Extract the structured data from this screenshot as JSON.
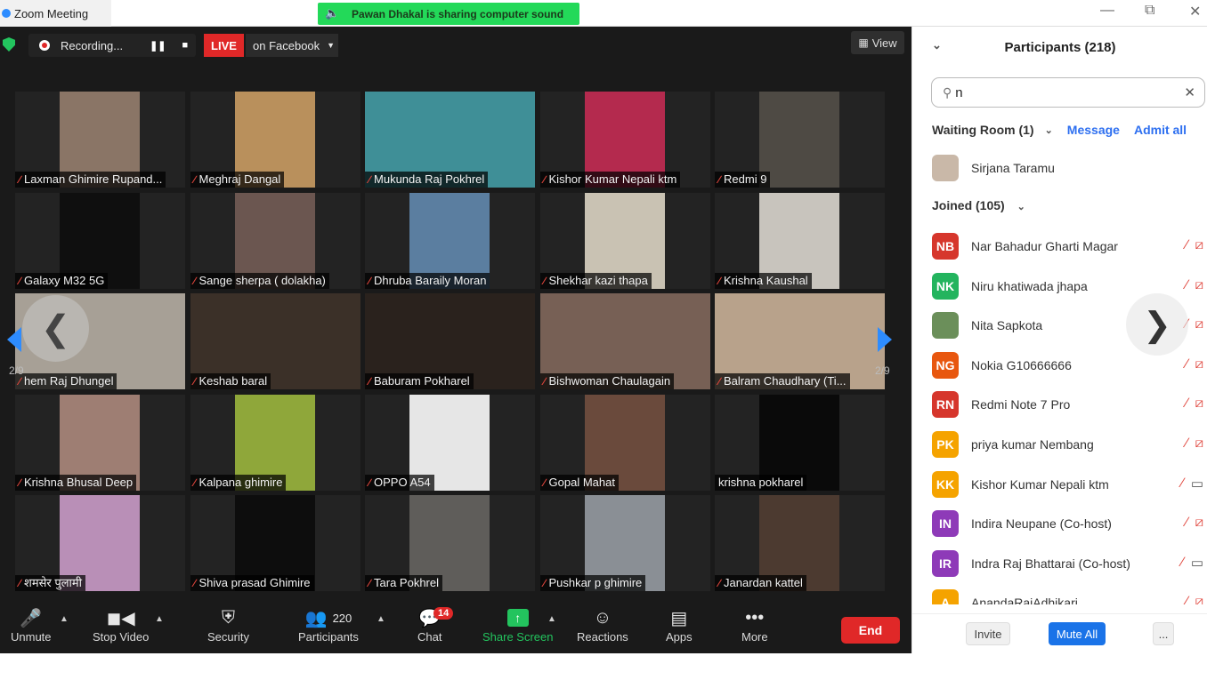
{
  "window": {
    "title": "Zoom Meeting",
    "share_banner": "Pawan Dhakal is sharing computer sound"
  },
  "topbar": {
    "recording_label": "Recording...",
    "live_label": "LIVE",
    "live_target": "on Facebook",
    "view_label": "View"
  },
  "grid": {
    "page_indicator": "2/9",
    "tiles": [
      {
        "name": "Laxman Ghimire Rupand...",
        "bg": "#8a7566"
      },
      {
        "name": "Meghraj Dangal",
        "bg": "#b9905c"
      },
      {
        "name": "Mukunda Raj  Pokhrel",
        "bg": "#3f8f97"
      },
      {
        "name": "Kishor Kumar Nepali ktm",
        "bg": "#b42a4e"
      },
      {
        "name": "Redmi 9",
        "bg": "#4e4a44"
      },
      {
        "name": "Galaxy M32 5G",
        "bg": "#0f0f0f"
      },
      {
        "name": "Sange sherpa ( dolakha)",
        "bg": "#6b5650"
      },
      {
        "name": "Dhruba Baraily Moran",
        "bg": "#5b7ea0"
      },
      {
        "name": "Shekhar kazi thapa",
        "bg": "#c9c2b3"
      },
      {
        "name": "Krishna Kaushal",
        "bg": "#c8c4bd"
      },
      {
        "name": "hem Raj Dhungel",
        "bg": "#a7a096"
      },
      {
        "name": "Keshab baral",
        "bg": "#3b3028"
      },
      {
        "name": "Baburam Pokharel",
        "bg": "#2a221d"
      },
      {
        "name": "Bishwoman Chaulagain",
        "bg": "#776055"
      },
      {
        "name": "Balram Chaudhary (Ti...",
        "bg": "#b8a28b"
      },
      {
        "name": "Krishna Bhusal Deep",
        "bg": "#9e7e73"
      },
      {
        "name": "Kalpana ghimire",
        "bg": "#8fa73a"
      },
      {
        "name": "OPPO A54",
        "bg": "#e6e6e6"
      },
      {
        "name": "Gopal Mahat",
        "bg": "#6a4a3c"
      },
      {
        "name": "krishna pokharel",
        "bg": "#0a0a0a",
        "unmuted": true
      },
      {
        "name": "शमसेर पुलामी",
        "bg": "#b98fb7"
      },
      {
        "name": "Shiva prasad Ghimire",
        "bg": "#0d0d0d"
      },
      {
        "name": "Tara Pokhrel",
        "bg": "#5f5d5a"
      },
      {
        "name": "Pushkar p ghimire",
        "bg": "#8a8f95"
      },
      {
        "name": "Janardan kattel",
        "bg": "#4c3a30"
      }
    ]
  },
  "toolbar": {
    "unmute": "Unmute",
    "stop_video": "Stop Video",
    "security": "Security",
    "participants": "Participants",
    "participants_count": "220",
    "chat": "Chat",
    "chat_badge": "14",
    "share_screen": "Share Screen",
    "reactions": "Reactions",
    "apps": "Apps",
    "more": "More",
    "end": "End"
  },
  "panel": {
    "title": "Participants (218)",
    "search_value": "n",
    "waiting_room_label": "Waiting Room (1)",
    "message_label": "Message",
    "admit_all_label": "Admit all",
    "waiting": [
      {
        "name": "Sirjana Taramu"
      }
    ],
    "joined_label": "Joined (105)",
    "participants": [
      {
        "initials": "NB",
        "name": "Nar Bahadur Gharti Magar",
        "color": "#d6362c",
        "video": "off"
      },
      {
        "initials": "NK",
        "name": "Niru khatiwada jhapa",
        "color": "#23b45e",
        "video": "off"
      },
      {
        "initials": "",
        "name": "Nita Sapkota",
        "color": "#6b8f5a",
        "video": "off"
      },
      {
        "initials": "NG",
        "name": "Nokia G10666666",
        "color": "#e8570f",
        "video": "off"
      },
      {
        "initials": "RN",
        "name": "Redmi Note 7 Pro",
        "color": "#d6362c",
        "video": "off"
      },
      {
        "initials": "PK",
        "name": "priya kumar Nembang",
        "color": "#f5a300",
        "video": "off"
      },
      {
        "initials": "KK",
        "name": "Kishor Kumar Nepali ktm",
        "color": "#f5a300",
        "video": "on"
      },
      {
        "initials": "IN",
        "name": "Indira Neupane (Co-host)",
        "color": "#8e3ab8",
        "video": "off"
      },
      {
        "initials": "IR",
        "name": "Indra Raj Bhattarai (Co-host)",
        "color": "#8e3ab8",
        "video": "on"
      },
      {
        "initials": "A",
        "name": "AnandaRajAdhikari",
        "color": "#f5a300",
        "video": "off"
      }
    ],
    "invite_label": "Invite",
    "mute_all_label": "Mute All",
    "more_label": "..."
  }
}
